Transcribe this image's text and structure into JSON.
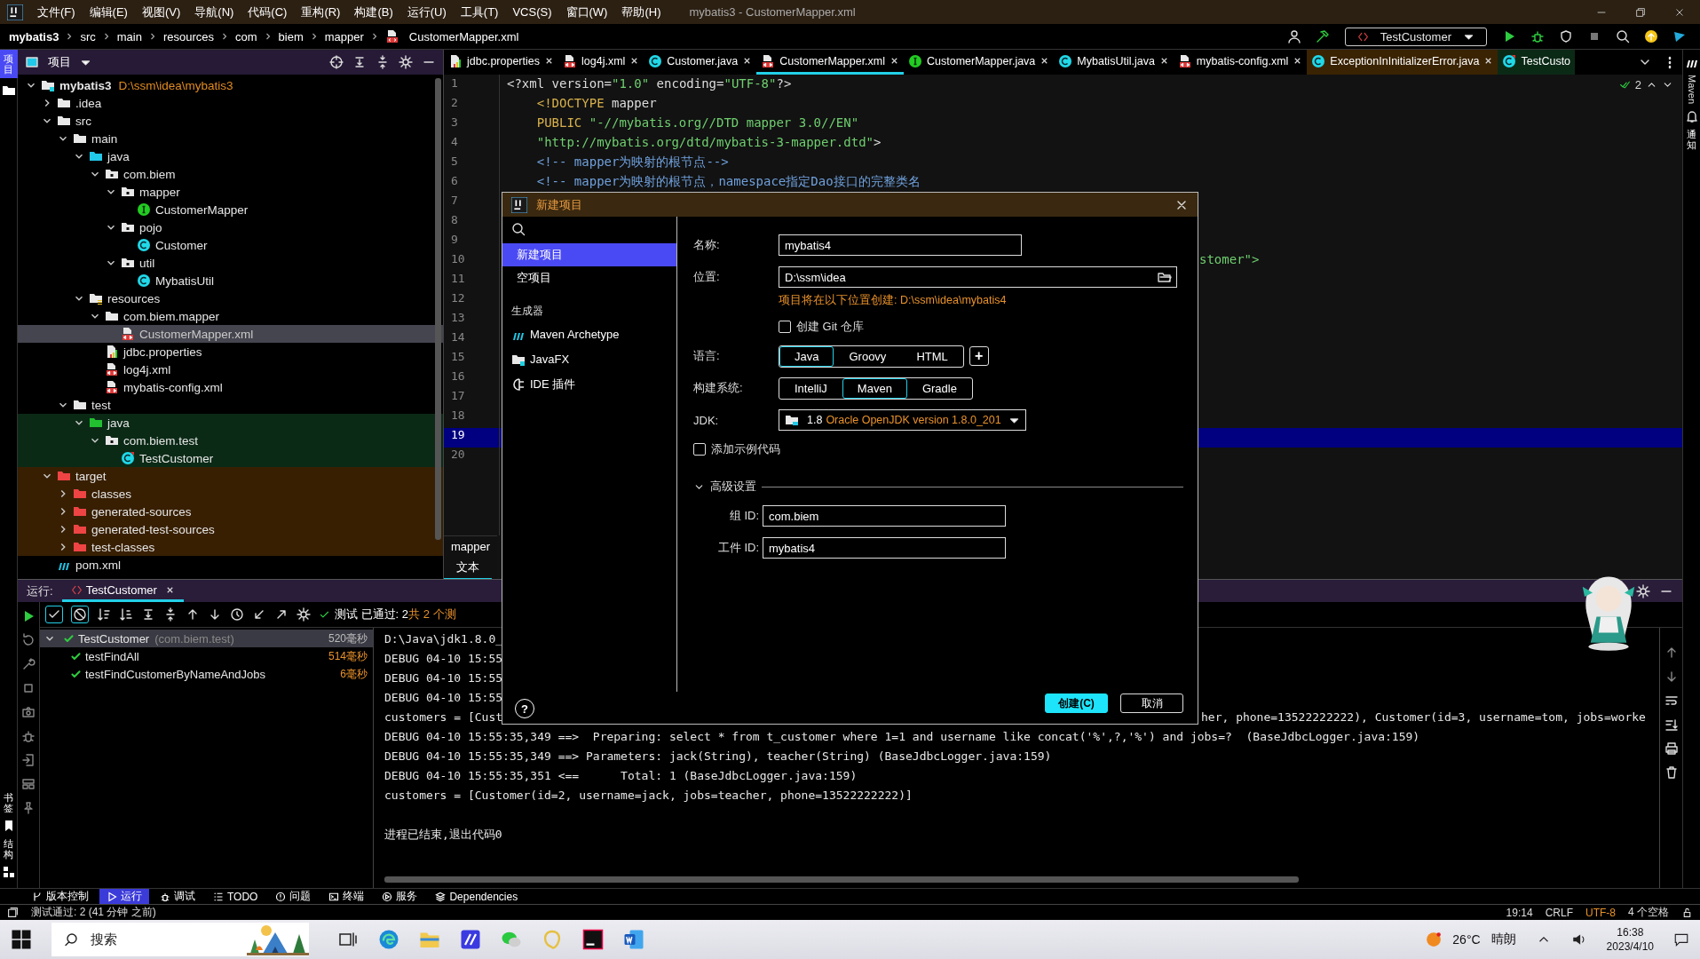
{
  "window": {
    "title": "mybatis3 - CustomerMapper.xml"
  },
  "menu": [
    "文件(F)",
    "编辑(E)",
    "视图(V)",
    "导航(N)",
    "代码(C)",
    "重构(R)",
    "构建(B)",
    "运行(U)",
    "工具(T)",
    "VCS(S)",
    "窗口(W)",
    "帮助(H)"
  ],
  "breadcrumb": [
    {
      "label": "mybatis3",
      "kind": "project"
    },
    {
      "label": "src",
      "kind": "folder"
    },
    {
      "label": "main",
      "kind": "folder"
    },
    {
      "label": "resources",
      "kind": "folder"
    },
    {
      "label": "com",
      "kind": "folder"
    },
    {
      "label": "biem",
      "kind": "folder"
    },
    {
      "label": "mapper",
      "kind": "folder"
    },
    {
      "label": "CustomerMapper.xml",
      "kind": "xml"
    }
  ],
  "run_config": "TestCustomer",
  "side_tabs": {
    "project": "项目",
    "bookmarks": "书签",
    "structure": "结构",
    "maven": "Maven",
    "notifications": "通知"
  },
  "project_panel": {
    "title": "项目",
    "tree": [
      {
        "label": "mybatis3",
        "path": "D:\\ssm\\idea\\mybatis3",
        "kind": "project",
        "expanded": true,
        "selected": false,
        "children": [
          {
            "label": ".idea",
            "kind": "folder",
            "expanded": false,
            "selected": false
          },
          {
            "label": "src",
            "kind": "folder",
            "expanded": true,
            "selected": false,
            "children": [
              {
                "label": "main",
                "kind": "folder",
                "expanded": true,
                "selected": false,
                "children": [
                  {
                    "label": "java",
                    "kind": "source",
                    "expanded": true,
                    "selected": false,
                    "children": [
                      {
                        "label": "com.biem",
                        "kind": "package",
                        "expanded": true,
                        "selected": false,
                        "children": [
                          {
                            "label": "mapper",
                            "kind": "package",
                            "expanded": true,
                            "selected": false,
                            "children": [
                              {
                                "label": "CustomerMapper",
                                "kind": "interface",
                                "selected": false
                              }
                            ]
                          },
                          {
                            "label": "pojo",
                            "kind": "package",
                            "expanded": true,
                            "selected": false,
                            "children": [
                              {
                                "label": "Customer",
                                "kind": "class",
                                "selected": false
                              }
                            ]
                          },
                          {
                            "label": "util",
                            "kind": "package",
                            "expanded": true,
                            "selected": false,
                            "children": [
                              {
                                "label": "MybatisUtil",
                                "kind": "class",
                                "selected": false
                              }
                            ]
                          }
                        ]
                      }
                    ]
                  },
                  {
                    "label": "resources",
                    "kind": "resources",
                    "expanded": true,
                    "selected": false,
                    "children": [
                      {
                        "label": "com.biem.mapper",
                        "kind": "folder",
                        "expanded": true,
                        "selected": false,
                        "children": [
                          {
                            "label": "CustomerMapper.xml",
                            "kind": "xml",
                            "selected": true
                          }
                        ]
                      },
                      {
                        "label": "jdbc.properties",
                        "kind": "properties",
                        "selected": false
                      },
                      {
                        "label": "log4j.xml",
                        "kind": "xml",
                        "selected": false
                      },
                      {
                        "label": "mybatis-config.xml",
                        "kind": "xml",
                        "selected": false
                      }
                    ]
                  }
                ]
              },
              {
                "label": "test",
                "kind": "folder",
                "expanded": true,
                "selected": false,
                "children": [
                  {
                    "label": "java",
                    "kind": "test-source",
                    "expanded": true,
                    "selected": false,
                    "test": true,
                    "children": [
                      {
                        "label": "com.biem.test",
                        "kind": "package",
                        "expanded": true,
                        "selected": false,
                        "children": [
                          {
                            "label": "TestCustomer",
                            "kind": "test-class",
                            "selected": false
                          }
                        ]
                      }
                    ]
                  }
                ]
              }
            ]
          },
          {
            "label": "target",
            "kind": "excluded",
            "expanded": true,
            "selected": false,
            "excluded": true,
            "children": [
              {
                "label": "classes",
                "kind": "excluded",
                "expanded": false,
                "selected": false
              },
              {
                "label": "generated-sources",
                "kind": "excluded",
                "expanded": false,
                "selected": false
              },
              {
                "label": "generated-test-sources",
                "kind": "excluded",
                "expanded": false,
                "selected": false
              },
              {
                "label": "test-classes",
                "kind": "excluded",
                "expanded": false,
                "selected": false
              }
            ]
          },
          {
            "label": "pom.xml",
            "kind": "maven",
            "selected": false
          }
        ]
      }
    ]
  },
  "editor": {
    "tabs": [
      {
        "label": "jdbc.properties",
        "kind": "properties",
        "selected": false,
        "test": false,
        "excluded": false
      },
      {
        "label": "log4j.xml",
        "kind": "xml",
        "selected": false,
        "test": false,
        "excluded": false
      },
      {
        "label": "Customer.java",
        "kind": "class",
        "selected": false,
        "test": false,
        "excluded": false
      },
      {
        "label": "CustomerMapper.xml",
        "kind": "xml",
        "selected": true,
        "test": false,
        "excluded": false
      },
      {
        "label": "CustomerMapper.java",
        "kind": "interface",
        "selected": false,
        "test": false,
        "excluded": false
      },
      {
        "label": "MybatisUtil.java",
        "kind": "class",
        "selected": false,
        "test": false,
        "excluded": false
      },
      {
        "label": "mybatis-config.xml",
        "kind": "xml",
        "selected": false,
        "test": false,
        "excluded": false
      },
      {
        "label": "ExceptionInInitializerError.java",
        "kind": "class",
        "selected": false,
        "test": false,
        "excluded": true
      },
      {
        "label": "TestCusto",
        "kind": "test-class",
        "selected": false,
        "test": true,
        "excluded": false
      }
    ],
    "inspections": "2",
    "lines": [
      {
        "number": "1",
        "current": false,
        "segments": [
          {
            "text": "<?xml version=",
            "kind": "plain"
          },
          {
            "text": "\"1.0\"",
            "kind": "string"
          },
          {
            "text": " encoding=",
            "kind": "plain"
          },
          {
            "text": "\"UTF-8\"",
            "kind": "string"
          },
          {
            "text": "?>",
            "kind": "plain"
          }
        ]
      },
      {
        "number": "2",
        "current": false,
        "segments": [
          {
            "text": "    <!DOCTYPE",
            "kind": "keyword"
          },
          {
            "text": " mapper",
            "kind": "plain"
          }
        ]
      },
      {
        "number": "3",
        "current": false,
        "segments": [
          {
            "text": "    PUBLIC ",
            "kind": "keyword"
          },
          {
            "text": "\"-//mybatis.org//DTD mapper 3.0//EN\"",
            "kind": "string"
          }
        ]
      },
      {
        "number": "4",
        "current": false,
        "segments": [
          {
            "text": "    \"http://mybatis.org/dtd/mybatis-3-mapper.dtd\"",
            "kind": "string"
          },
          {
            "text": ">",
            "kind": "plain"
          }
        ]
      },
      {
        "number": "5",
        "current": false,
        "segments": [
          {
            "text": "    <!-- mapper为映射的根节点-->",
            "kind": "comment"
          }
        ]
      },
      {
        "number": "6",
        "current": false,
        "segments": [
          {
            "text": "    <!-- mapper为映射的根节点，namespace指定Dao接口的完整类名",
            "kind": "comment"
          }
        ]
      },
      {
        "number": "7",
        "current": false
      },
      {
        "number": "8",
        "current": false
      },
      {
        "number": "9",
        "current": false
      },
      {
        "number": "10",
        "current": false,
        "covered": true,
        "segments": [
          {
            "text": "stomer\">",
            "kind": "string"
          }
        ]
      },
      {
        "number": "11",
        "current": false
      },
      {
        "number": "12",
        "current": false
      },
      {
        "number": "13",
        "current": false
      },
      {
        "number": "14",
        "current": false
      },
      {
        "number": "15",
        "current": false
      },
      {
        "number": "16",
        "current": false
      },
      {
        "number": "17",
        "current": false
      },
      {
        "number": "18",
        "current": false
      },
      {
        "number": "19",
        "current": true
      },
      {
        "number": "20",
        "current": false
      }
    ],
    "structure_path": "mapper",
    "view_tabs": [
      {
        "label": "文本",
        "selected": true
      }
    ]
  },
  "run_panel": {
    "label": "运行:",
    "tabs": [
      {
        "label": "TestCustomer",
        "selected": true
      }
    ],
    "filters": [
      {
        "kind": "passed",
        "on": true
      },
      {
        "kind": "ignored",
        "on": true
      }
    ],
    "summary": {
      "passed": "测试 已通过: 2",
      "total": "共 2 个测"
    },
    "tests": [
      {
        "name": "TestCustomer",
        "detail": "(com.biem.test)",
        "time": "520毫秒",
        "passed": true,
        "selected": true,
        "expanded": true,
        "children": [
          {
            "name": "testFindAll",
            "time": "514毫秒",
            "passed": true,
            "selected": false
          },
          {
            "name": "testFindCustomerByNameAndJobs",
            "time": "6毫秒",
            "passed": true,
            "selected": false
          }
        ]
      }
    ],
    "console": [
      {
        "kind": "log",
        "parts": [
          "D:\\Java\\jdk1.8.0_"
        ]
      },
      {
        "kind": "log",
        "parts": [
          "DEBUG 04-10 15:55"
        ]
      },
      {
        "kind": "log",
        "parts": [
          "DEBUG 04-10 15:55"
        ]
      },
      {
        "kind": "log",
        "parts": [
          "DEBUG 04-10 15:55"
        ]
      },
      {
        "kind": "log",
        "parts": [
          "customers = [Cust",
          "her, phone=13522222222), Customer(id=3, username=tom, jobs=worke"
        ]
      },
      {
        "kind": "log",
        "parts": [
          "DEBUG 04-10 15:55:35,349 ==>  Preparing: select * from t_customer where 1=1 and username like concat('%',?,'%') and jobs=?  (BaseJdbcLogger.java:159)"
        ]
      },
      {
        "kind": "log",
        "parts": [
          "DEBUG 04-10 15:55:35,349 ==> Parameters: jack(String), teacher(String) (BaseJdbcLogger.java:159)"
        ]
      },
      {
        "kind": "log",
        "parts": [
          "DEBUG 04-10 15:55:35,351 <==      Total: 1 (BaseJdbcLogger.java:159)"
        ]
      },
      {
        "kind": "log",
        "parts": [
          "customers = [Customer(id=2, username=jack, jobs=teacher, phone=13522222222)]"
        ]
      },
      {
        "kind": "exit",
        "parts": [
          "进程已结束,退出代码0"
        ]
      }
    ]
  },
  "tool_windows": [
    {
      "label": "版本控制",
      "kind": "vcs",
      "selected": false
    },
    {
      "label": "运行",
      "kind": "run",
      "selected": true
    },
    {
      "label": "调试",
      "kind": "debug",
      "selected": false
    },
    {
      "label": "TODO",
      "kind": "todo",
      "selected": false
    },
    {
      "label": "问题",
      "kind": "problems",
      "selected": false
    },
    {
      "label": "终端",
      "kind": "terminal",
      "selected": false
    },
    {
      "label": "服务",
      "kind": "services",
      "selected": false
    },
    {
      "label": "Dependencies",
      "kind": "deps",
      "selected": false
    }
  ],
  "status_bar": {
    "message": "测试通过: 2 (41 分钟 之前)",
    "position": "19:14",
    "line_ending": "CRLF",
    "encoding": "UTF-8",
    "indent": "4 个空格"
  },
  "dialog": {
    "title": "新建项目",
    "nav": [
      {
        "label": "新建项目",
        "selected": true
      },
      {
        "label": "空项目",
        "selected": false
      }
    ],
    "generators_heading": "生成器",
    "generators": [
      {
        "label": "Maven Archetype",
        "kind": "maven",
        "selected": false
      },
      {
        "label": "JavaFX",
        "kind": "javafx",
        "selected": false
      },
      {
        "label": "IDE 插件",
        "kind": "plugin",
        "selected": false
      }
    ],
    "name": {
      "label": "名称:",
      "value": "mybatis4"
    },
    "location": {
      "label": "位置:",
      "value": "D:\\ssm\\idea"
    },
    "location_hint": "项目将在以下位置创建: D:\\ssm\\idea\\mybatis4",
    "git": {
      "label": "创建 Git 仓库",
      "checked": false
    },
    "language": {
      "label": "语言:",
      "options": [
        {
          "label": "Java",
          "selected": true
        },
        {
          "label": "Groovy",
          "selected": false
        },
        {
          "label": "HTML",
          "selected": false
        }
      ],
      "add": "+"
    },
    "build": {
      "label": "构建系统:",
      "options": [
        {
          "label": "IntelliJ",
          "selected": false
        },
        {
          "label": "Maven",
          "selected": true
        },
        {
          "label": "Gradle",
          "selected": false
        }
      ]
    },
    "jdk": {
      "label": "JDK:",
      "version": "1.8",
      "name": "Oracle OpenJDK version 1.8.0_201"
    },
    "sample": {
      "label": "添加示例代码",
      "checked": false
    },
    "advanced": {
      "label": "高级设置",
      "expanded": true
    },
    "group_id": {
      "label": "组 ID:",
      "value": "com.biem"
    },
    "artifact_id": {
      "label": "工件 ID:",
      "value": "mybatis4"
    },
    "help": "?",
    "buttons": [
      {
        "label": "创建(C)",
        "primary": true
      },
      {
        "label": "取消",
        "primary": false
      }
    ]
  },
  "taskbar": {
    "search": "搜索",
    "weather": {
      "temp": "26°C",
      "condition": "晴朗"
    },
    "time": "16:38",
    "date": "2023/4/10"
  }
}
